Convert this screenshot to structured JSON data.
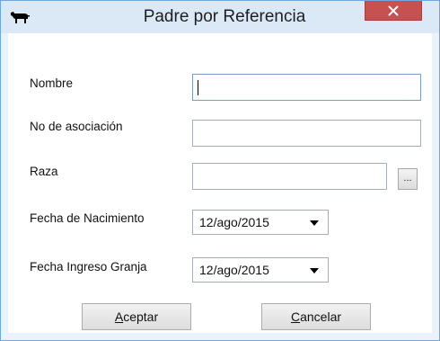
{
  "window": {
    "title": "Padre por Referencia",
    "app_icon": "bull-icon",
    "close_icon": "close-icon",
    "title_color": "#dbe9f7",
    "close_color": "#c75050"
  },
  "form": {
    "nombre_label": "Nombre",
    "nombre_value": "",
    "asociacion_label": "No de asociación",
    "asociacion_value": "",
    "raza_label": "Raza",
    "raza_value": "",
    "raza_browse_label": "...",
    "nacimiento_label": "Fecha de Nacimiento",
    "nacimiento_value": "12/ago/2015",
    "ingreso_label": "Fecha Ingreso Granja",
    "ingreso_value": "12/ago/2015"
  },
  "buttons": {
    "accept_mnemonic": "A",
    "accept_rest": "ceptar",
    "cancel_mnemonic": "C",
    "cancel_rest": "ancelar"
  }
}
